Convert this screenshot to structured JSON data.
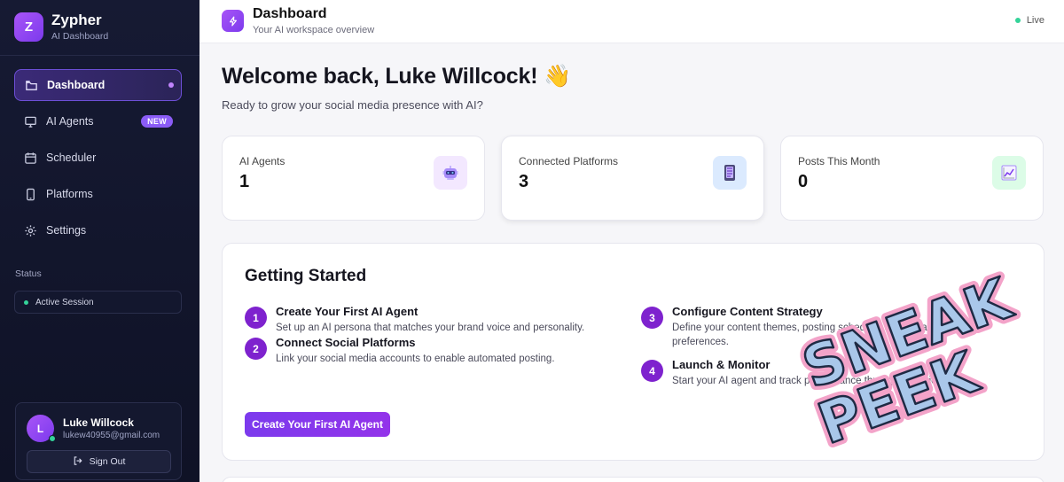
{
  "brand": {
    "logo_letter": "Z",
    "name": "Zypher",
    "subtitle": "AI Dashboard"
  },
  "sidebar": {
    "items": [
      {
        "label": "Dashboard",
        "icon": "folder-icon",
        "active": true
      },
      {
        "label": "AI Agents",
        "icon": "monitor-icon",
        "badge": "NEW"
      },
      {
        "label": "Scheduler",
        "icon": "calendar-icon"
      },
      {
        "label": "Platforms",
        "icon": "phone-icon"
      },
      {
        "label": "Settings",
        "icon": "gear-icon"
      }
    ],
    "status_label": "Status",
    "status_value": "Active Session"
  },
  "user": {
    "initial": "L",
    "name": "Luke Willcock",
    "email": "lukew40955@gmail.com",
    "signout_label": "Sign Out"
  },
  "header": {
    "title": "Dashboard",
    "subtitle": "Your AI workspace overview",
    "status": "Live"
  },
  "main": {
    "welcome": "Welcome back, Luke Willcock! 👋",
    "welcome_sub": "Ready to grow your social media presence with AI?",
    "stats": [
      {
        "label": "AI Agents",
        "value": "1",
        "icon": "robot-icon"
      },
      {
        "label": "Connected Platforms",
        "value": "3",
        "icon": "tablet-icon"
      },
      {
        "label": "Posts This Month",
        "value": "0",
        "icon": "chart-up-icon"
      }
    ],
    "getting_started": {
      "title": "Getting Started",
      "steps": [
        {
          "num": "1",
          "title": "Create Your First AI Agent",
          "desc": "Set up an AI persona that matches your brand voice and personality."
        },
        {
          "num": "2",
          "title": "Connect Social Platforms",
          "desc": "Link your social media accounts to enable automated posting."
        },
        {
          "num": "3",
          "title": "Configure Content Strategy",
          "desc": "Define your content themes, posting schedule, and engagement preferences."
        },
        {
          "num": "4",
          "title": "Launch & Monitor",
          "desc": "Start your AI agent and track performance through analytics."
        }
      ],
      "cta_label": "Create Your First AI Agent"
    }
  },
  "sticker": {
    "line1": "SNEAK",
    "line2": "PEEK"
  },
  "colors": {
    "accent": "#7c3aed",
    "sidebar_bg": "#111428",
    "live": "#34d399"
  }
}
